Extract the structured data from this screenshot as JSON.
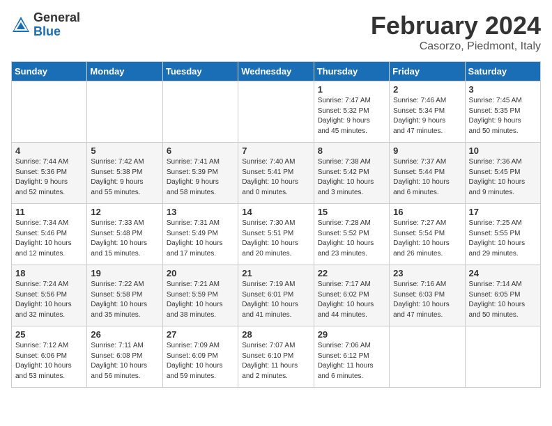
{
  "logo": {
    "general": "General",
    "blue": "Blue"
  },
  "title": "February 2024",
  "location": "Casorzo, Piedmont, Italy",
  "days_of_week": [
    "Sunday",
    "Monday",
    "Tuesday",
    "Wednesday",
    "Thursday",
    "Friday",
    "Saturday"
  ],
  "weeks": [
    [
      {
        "day": "",
        "info": ""
      },
      {
        "day": "",
        "info": ""
      },
      {
        "day": "",
        "info": ""
      },
      {
        "day": "",
        "info": ""
      },
      {
        "day": "1",
        "info": "Sunrise: 7:47 AM\nSunset: 5:32 PM\nDaylight: 9 hours\nand 45 minutes."
      },
      {
        "day": "2",
        "info": "Sunrise: 7:46 AM\nSunset: 5:34 PM\nDaylight: 9 hours\nand 47 minutes."
      },
      {
        "day": "3",
        "info": "Sunrise: 7:45 AM\nSunset: 5:35 PM\nDaylight: 9 hours\nand 50 minutes."
      }
    ],
    [
      {
        "day": "4",
        "info": "Sunrise: 7:44 AM\nSunset: 5:36 PM\nDaylight: 9 hours\nand 52 minutes."
      },
      {
        "day": "5",
        "info": "Sunrise: 7:42 AM\nSunset: 5:38 PM\nDaylight: 9 hours\nand 55 minutes."
      },
      {
        "day": "6",
        "info": "Sunrise: 7:41 AM\nSunset: 5:39 PM\nDaylight: 9 hours\nand 58 minutes."
      },
      {
        "day": "7",
        "info": "Sunrise: 7:40 AM\nSunset: 5:41 PM\nDaylight: 10 hours\nand 0 minutes."
      },
      {
        "day": "8",
        "info": "Sunrise: 7:38 AM\nSunset: 5:42 PM\nDaylight: 10 hours\nand 3 minutes."
      },
      {
        "day": "9",
        "info": "Sunrise: 7:37 AM\nSunset: 5:44 PM\nDaylight: 10 hours\nand 6 minutes."
      },
      {
        "day": "10",
        "info": "Sunrise: 7:36 AM\nSunset: 5:45 PM\nDaylight: 10 hours\nand 9 minutes."
      }
    ],
    [
      {
        "day": "11",
        "info": "Sunrise: 7:34 AM\nSunset: 5:46 PM\nDaylight: 10 hours\nand 12 minutes."
      },
      {
        "day": "12",
        "info": "Sunrise: 7:33 AM\nSunset: 5:48 PM\nDaylight: 10 hours\nand 15 minutes."
      },
      {
        "day": "13",
        "info": "Sunrise: 7:31 AM\nSunset: 5:49 PM\nDaylight: 10 hours\nand 17 minutes."
      },
      {
        "day": "14",
        "info": "Sunrise: 7:30 AM\nSunset: 5:51 PM\nDaylight: 10 hours\nand 20 minutes."
      },
      {
        "day": "15",
        "info": "Sunrise: 7:28 AM\nSunset: 5:52 PM\nDaylight: 10 hours\nand 23 minutes."
      },
      {
        "day": "16",
        "info": "Sunrise: 7:27 AM\nSunset: 5:54 PM\nDaylight: 10 hours\nand 26 minutes."
      },
      {
        "day": "17",
        "info": "Sunrise: 7:25 AM\nSunset: 5:55 PM\nDaylight: 10 hours\nand 29 minutes."
      }
    ],
    [
      {
        "day": "18",
        "info": "Sunrise: 7:24 AM\nSunset: 5:56 PM\nDaylight: 10 hours\nand 32 minutes."
      },
      {
        "day": "19",
        "info": "Sunrise: 7:22 AM\nSunset: 5:58 PM\nDaylight: 10 hours\nand 35 minutes."
      },
      {
        "day": "20",
        "info": "Sunrise: 7:21 AM\nSunset: 5:59 PM\nDaylight: 10 hours\nand 38 minutes."
      },
      {
        "day": "21",
        "info": "Sunrise: 7:19 AM\nSunset: 6:01 PM\nDaylight: 10 hours\nand 41 minutes."
      },
      {
        "day": "22",
        "info": "Sunrise: 7:17 AM\nSunset: 6:02 PM\nDaylight: 10 hours\nand 44 minutes."
      },
      {
        "day": "23",
        "info": "Sunrise: 7:16 AM\nSunset: 6:03 PM\nDaylight: 10 hours\nand 47 minutes."
      },
      {
        "day": "24",
        "info": "Sunrise: 7:14 AM\nSunset: 6:05 PM\nDaylight: 10 hours\nand 50 minutes."
      }
    ],
    [
      {
        "day": "25",
        "info": "Sunrise: 7:12 AM\nSunset: 6:06 PM\nDaylight: 10 hours\nand 53 minutes."
      },
      {
        "day": "26",
        "info": "Sunrise: 7:11 AM\nSunset: 6:08 PM\nDaylight: 10 hours\nand 56 minutes."
      },
      {
        "day": "27",
        "info": "Sunrise: 7:09 AM\nSunset: 6:09 PM\nDaylight: 10 hours\nand 59 minutes."
      },
      {
        "day": "28",
        "info": "Sunrise: 7:07 AM\nSunset: 6:10 PM\nDaylight: 11 hours\nand 2 minutes."
      },
      {
        "day": "29",
        "info": "Sunrise: 7:06 AM\nSunset: 6:12 PM\nDaylight: 11 hours\nand 6 minutes."
      },
      {
        "day": "",
        "info": ""
      },
      {
        "day": "",
        "info": ""
      }
    ]
  ]
}
